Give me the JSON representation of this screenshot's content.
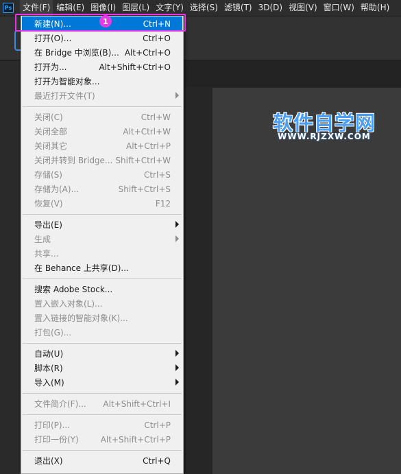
{
  "app": {
    "logo": "Ps"
  },
  "menubar": [
    "文件(F)",
    "编辑(E)",
    "图像(I)",
    "图层(L)",
    "文字(Y)",
    "选择(S)",
    "滤镜(T)",
    "3D(D)",
    "视图(V)",
    "窗口(W)",
    "帮助(H)"
  ],
  "watermark": {
    "cn": "软件自学网",
    "en": "WWW.RJZXW.COM"
  },
  "annotation": {
    "badge": "1"
  },
  "colors": {
    "highlight": "#0078d7",
    "annotation": "#e634e6"
  },
  "file_menu": {
    "groups": [
      [
        {
          "label": "新建(N)...",
          "shortcut": "Ctrl+N",
          "enabled": true,
          "highlight": true
        },
        {
          "label": "打开(O)...",
          "shortcut": "Ctrl+O",
          "enabled": true
        },
        {
          "label": "在 Bridge 中浏览(B)...",
          "shortcut": "Alt+Ctrl+O",
          "enabled": true
        },
        {
          "label": "打开为...",
          "shortcut": "Alt+Shift+Ctrl+O",
          "enabled": true
        },
        {
          "label": "打开为智能对象...",
          "shortcut": "",
          "enabled": true
        },
        {
          "label": "最近打开文件(T)",
          "shortcut": "",
          "enabled": false,
          "submenu": true
        }
      ],
      [
        {
          "label": "关闭(C)",
          "shortcut": "Ctrl+W",
          "enabled": false
        },
        {
          "label": "关闭全部",
          "shortcut": "Alt+Ctrl+W",
          "enabled": false
        },
        {
          "label": "关闭其它",
          "shortcut": "Alt+Ctrl+P",
          "enabled": false
        },
        {
          "label": "关闭并转到 Bridge...",
          "shortcut": "Shift+Ctrl+W",
          "enabled": false
        },
        {
          "label": "存储(S)",
          "shortcut": "Ctrl+S",
          "enabled": false
        },
        {
          "label": "存储为(A)...",
          "shortcut": "Shift+Ctrl+S",
          "enabled": false
        },
        {
          "label": "恢复(V)",
          "shortcut": "F12",
          "enabled": false
        }
      ],
      [
        {
          "label": "导出(E)",
          "shortcut": "",
          "enabled": true,
          "submenu": true
        },
        {
          "label": "生成",
          "shortcut": "",
          "enabled": false,
          "submenu": true
        },
        {
          "label": "共享...",
          "shortcut": "",
          "enabled": false
        },
        {
          "label": "在 Behance 上共享(D)...",
          "shortcut": "",
          "enabled": true
        }
      ],
      [
        {
          "label": "搜索 Adobe Stock...",
          "shortcut": "",
          "enabled": true
        },
        {
          "label": "置入嵌入对象(L)...",
          "shortcut": "",
          "enabled": false
        },
        {
          "label": "置入链接的智能对象(K)...",
          "shortcut": "",
          "enabled": false
        },
        {
          "label": "打包(G)...",
          "shortcut": "",
          "enabled": false
        }
      ],
      [
        {
          "label": "自动(U)",
          "shortcut": "",
          "enabled": true,
          "submenu": true
        },
        {
          "label": "脚本(R)",
          "shortcut": "",
          "enabled": true,
          "submenu": true
        },
        {
          "label": "导入(M)",
          "shortcut": "",
          "enabled": true,
          "submenu": true
        }
      ],
      [
        {
          "label": "文件简介(F)...",
          "shortcut": "Alt+Shift+Ctrl+I",
          "enabled": false
        }
      ],
      [
        {
          "label": "打印(P)...",
          "shortcut": "Ctrl+P",
          "enabled": false
        },
        {
          "label": "打印一份(Y)",
          "shortcut": "Alt+Shift+Ctrl+P",
          "enabled": false
        }
      ],
      [
        {
          "label": "退出(X)",
          "shortcut": "Ctrl+Q",
          "enabled": true
        }
      ]
    ]
  }
}
